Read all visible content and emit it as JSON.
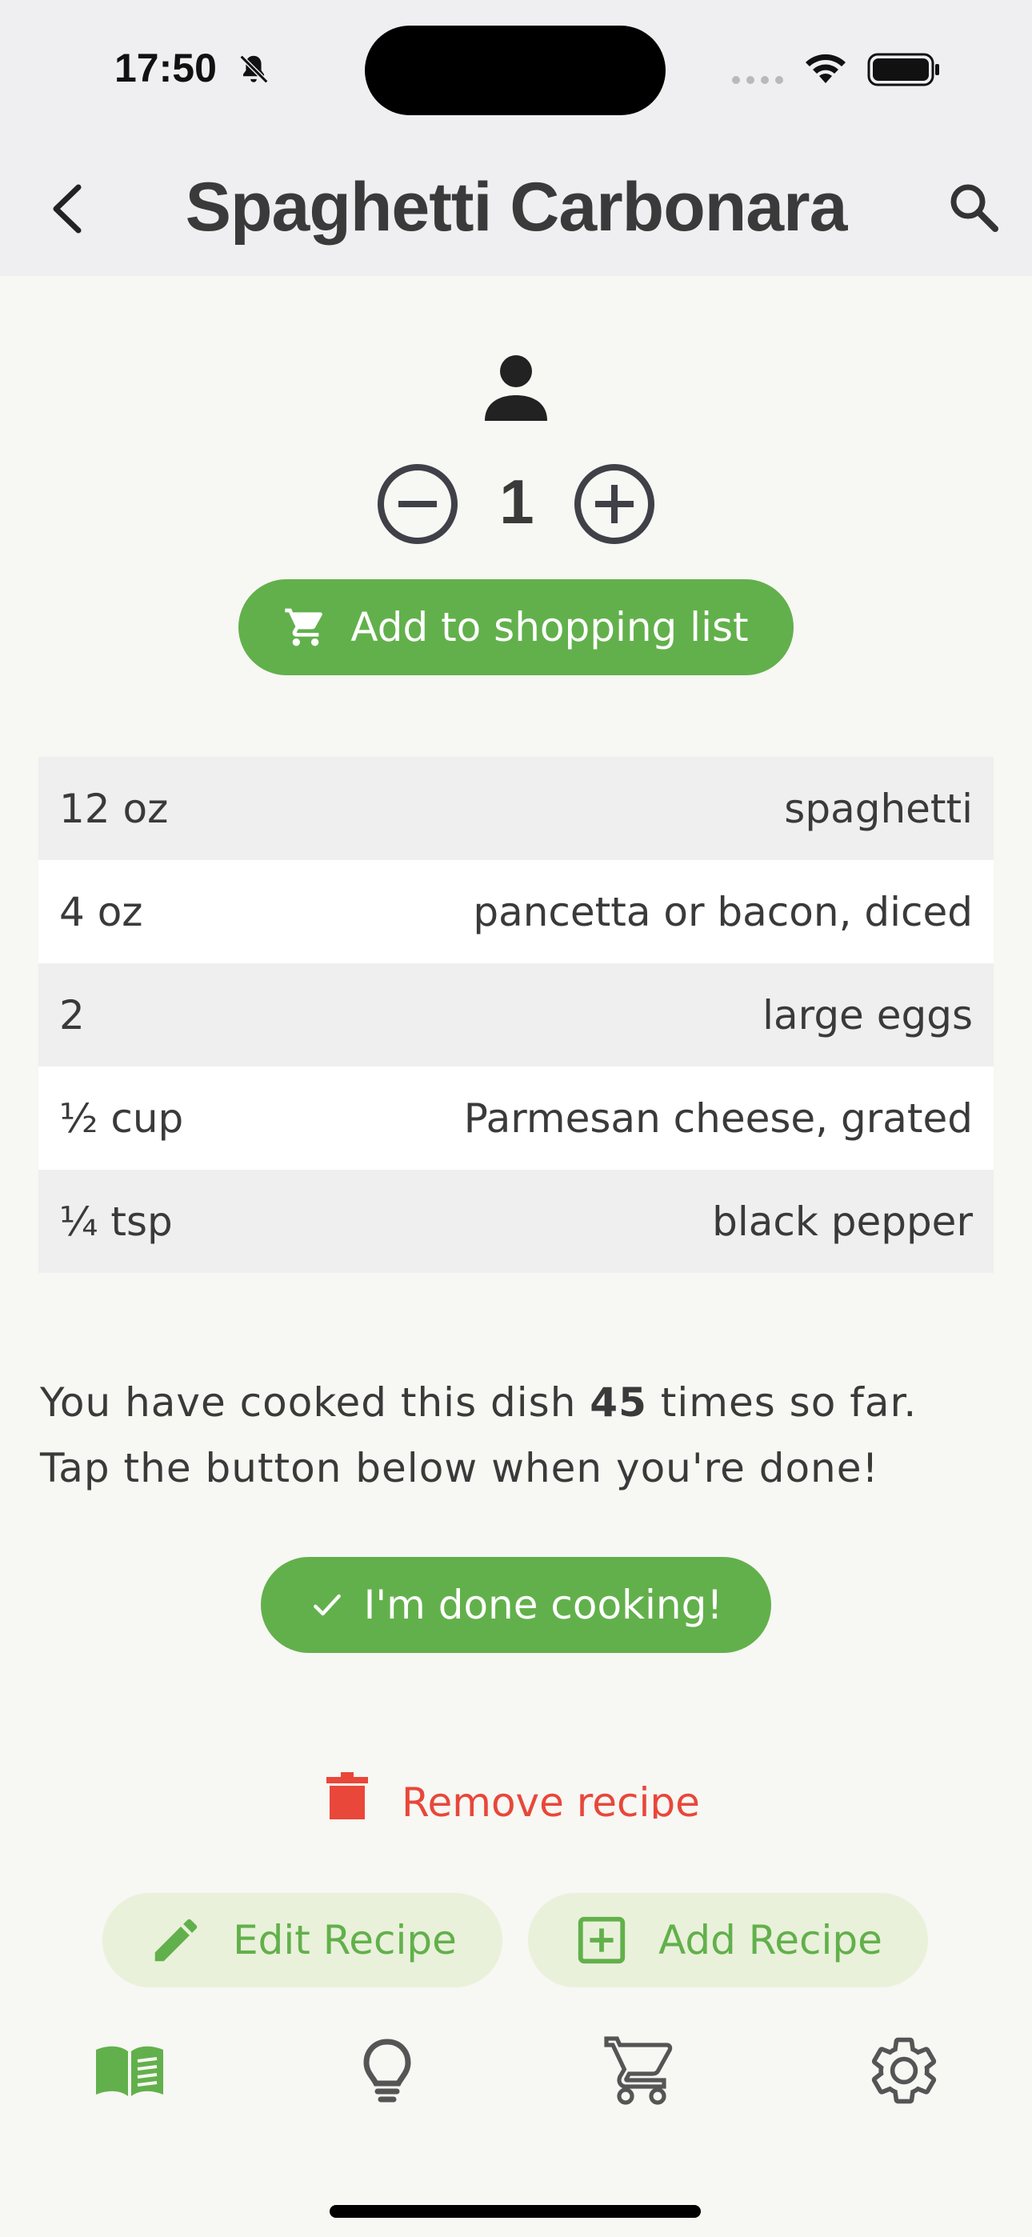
{
  "status_bar": {
    "time": "17:50",
    "icons": [
      "bell-slash-icon",
      "signal-icon",
      "wifi-icon",
      "battery-icon"
    ]
  },
  "app_bar": {
    "title": "Spaghetti Carbonara",
    "back_icon": "chevron-left-icon",
    "search_icon": "search-icon"
  },
  "servings": {
    "icon": "person-icon",
    "count": "1",
    "decrement_icon": "minus-circle-icon",
    "increment_icon": "plus-circle-icon"
  },
  "shopping_button": {
    "label": "Add to shopping list",
    "icon": "cart-icon"
  },
  "ingredients": [
    {
      "amount": "12 oz",
      "name": "spaghetti"
    },
    {
      "amount": "4 oz",
      "name": "pancetta or bacon, diced"
    },
    {
      "amount": "2",
      "name": "large eggs"
    },
    {
      "amount": "½ cup",
      "name": "Parmesan cheese, grated"
    },
    {
      "amount": "¼ tsp",
      "name": "black pepper"
    }
  ],
  "cooked": {
    "prefix": "You have cooked this dish ",
    "count": "45",
    "suffix": " times so far.",
    "line2": "Tap the button below when you're done!"
  },
  "done_button": {
    "label": "I'm done cooking!",
    "icon": "check-icon"
  },
  "remove_button": {
    "label": "Remove recipe",
    "icon": "trash-icon"
  },
  "edit_button": {
    "label": "Edit Recipe",
    "icon": "pencil-icon"
  },
  "add_button": {
    "label": "Add Recipe",
    "icon": "plus-box-icon"
  },
  "bottom_nav": [
    {
      "name": "recipes",
      "icon": "book-icon",
      "active": true
    },
    {
      "name": "ideas",
      "icon": "lightbulb-icon",
      "active": false
    },
    {
      "name": "shopping",
      "icon": "cart-icon",
      "active": false
    },
    {
      "name": "settings",
      "icon": "gear-icon",
      "active": false
    }
  ],
  "colors": {
    "accent": "#62b04b",
    "accent_tonal": "#e9f1da",
    "danger": "#e8473a",
    "background": "#f7f7f3",
    "appbar": "#efeff1",
    "text": "#3a3a3a"
  }
}
